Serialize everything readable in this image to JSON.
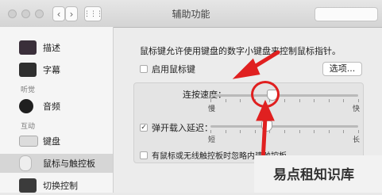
{
  "window": {
    "title": "辅助功能"
  },
  "sidebar": {
    "items": [
      {
        "label": "描述",
        "icon": "monitor-icon"
      },
      {
        "label": "字幕",
        "icon": "captions-icon"
      },
      {
        "label": "音频",
        "icon": "speaker-icon"
      },
      {
        "label": "键盘",
        "icon": "keyboard-icon"
      },
      {
        "label": "鼠标与触控板",
        "icon": "mouse-icon"
      },
      {
        "label": "切换控制",
        "icon": "switch-control-icon"
      }
    ],
    "groups": [
      "听觉",
      "互动"
    ]
  },
  "main": {
    "description": "鼠标键允许使用键盘的数字小键盘来控制鼠标指针。",
    "enable_mouse_keys": {
      "label": "启用鼠标键",
      "checked": false
    },
    "options_button": "选项...",
    "initial_delay_slider": {
      "label": "连按速度：",
      "min_label": "慢",
      "max_label": "快",
      "value": 0.42
    },
    "spring_loading": {
      "label": "弹开载入延迟：",
      "checked": true,
      "min_label": "短",
      "max_label": "长",
      "value": 0.38
    },
    "ignore_trackpad": {
      "label": "有鼠标或无线触控板时忽略内建触控板",
      "checked": false
    }
  },
  "watermark": "易点租知识库",
  "colors": {
    "annotation": "#e02020"
  }
}
